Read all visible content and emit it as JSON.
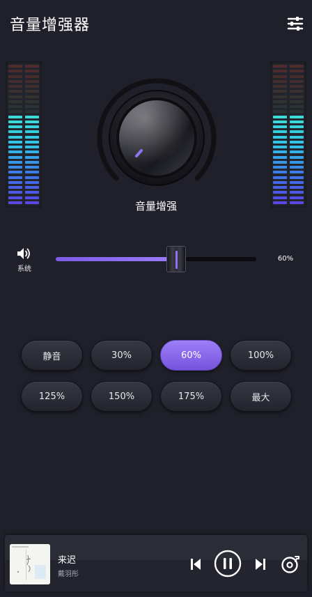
{
  "header": {
    "title": "音量增强器",
    "settings_icon": "sliders-icon"
  },
  "knob": {
    "label": "音量增强"
  },
  "volume": {
    "system_label": "系统",
    "percent_label": "60%",
    "level_fraction": 0.6,
    "accent": "#8f73f0"
  },
  "presets": [
    {
      "label": "静音",
      "active": false
    },
    {
      "label": "30%",
      "active": false
    },
    {
      "label": "60%",
      "active": true
    },
    {
      "label": "100%",
      "active": false
    },
    {
      "label": "125%",
      "active": false
    },
    {
      "label": "150%",
      "active": false
    },
    {
      "label": "175%",
      "active": false
    },
    {
      "label": "最大",
      "active": false
    }
  ],
  "player": {
    "song_title": "来迟",
    "artist": "戴羽彤"
  },
  "vu_meter": {
    "segments": 28,
    "lit_segments": 18
  },
  "colors": {
    "background": "#1f2029",
    "active_button": "#8a6cf0"
  }
}
